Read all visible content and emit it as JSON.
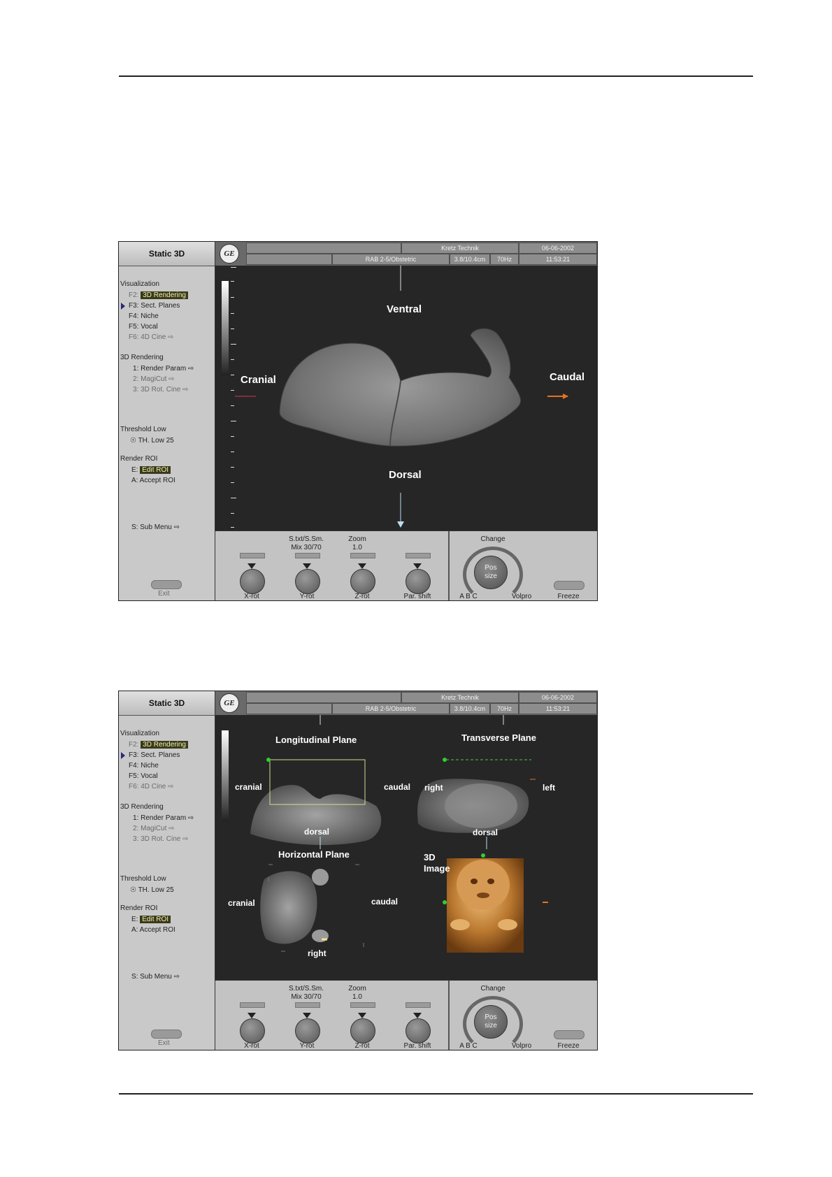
{
  "screens": [
    {
      "sidebar": {
        "title": "Static 3D",
        "visualization": "Visualization",
        "f2": "F2:",
        "f2_label": "3D Rendering",
        "f3": "F3:  Sect. Planes",
        "f4": "F4:  Niche",
        "f5": "F5:  Vocal",
        "f6": "F6:  4D Cine ⇨",
        "rendering": "3D Rendering",
        "r1": "1:  Render Param ⇨",
        "r2": "2:  MagiCut ⇨",
        "r3": "3:  3D Rot. Cine ⇨",
        "threshold": "Threshold Low",
        "th_low": "TH. Low    25",
        "render_roi": "Render ROI",
        "e": "E:",
        "edit_roi": "Edit ROI",
        "accept_roi": "A:  Accept ROI",
        "sub_menu": "S:  Sub Menu ⇨",
        "exit": "Exit"
      },
      "topbar": {
        "vendor": "Kretz Technik",
        "date": "06-06-2002",
        "probe": "RAB 2-5/Obstetric",
        "depth": "3.8/10.4cm",
        "freq": "70Hz",
        "time": "11:53:21"
      },
      "view_labels": {
        "top": "Ventral",
        "left": "Cranial",
        "right": "Caudal",
        "bottom": "Dorsal"
      },
      "controls": {
        "mix_title": "S.txt/S.Sm.",
        "mix_value": "Mix 30/70",
        "zoom_title": "Zoom",
        "zoom_value": "1.0",
        "x_rot": "X-rot",
        "y_rot": "Y-rot",
        "z_rot": "Z-rot",
        "par_shift": "Par. shift",
        "change": "Change",
        "pos": "Pos",
        "size": "size",
        "abc": "A B C",
        "volpro": "Volpro",
        "freeze": "Freeze"
      }
    },
    {
      "sidebar": {
        "title": "Static 3D",
        "visualization": "Visualization",
        "f2": "F2:",
        "f2_label": "3D Rendering",
        "f3": "F3:  Sect. Planes",
        "f4": "F4:  Niche",
        "f5": "F5:  Vocal",
        "f6": "F6:  4D Cine ⇨",
        "rendering": "3D Rendering",
        "r1": "1:  Render Param ⇨",
        "r2": "2:  MagiCut ⇨",
        "r3": "3:  3D Rot. Cine ⇨",
        "threshold": "Threshold Low",
        "th_low": "TH. Low    25",
        "render_roi": "Render ROI",
        "e": "E:",
        "edit_roi": "Edit ROI",
        "accept_roi": "A:  Accept ROI",
        "sub_menu": "S:  Sub Menu ⇨",
        "exit": "Exit"
      },
      "topbar": {
        "vendor": "Kretz Technik",
        "date": "06-06-2002",
        "probe": "RAB 2-5/Obstetric",
        "depth": "3.8/10.4cm",
        "freq": "70Hz",
        "time": "11:53:21"
      },
      "quad": {
        "long_title": "Longitudinal Plane",
        "trans_title": "Transverse Plane",
        "horiz_title": "Horizontal Plane",
        "image_title_1": "3D",
        "image_title_2": "Image",
        "cranial": "cranial",
        "caudal": "caudal",
        "dorsal": "dorsal",
        "right": "right",
        "left": "left"
      },
      "controls": {
        "mix_title": "S.txt/S.Sm.",
        "mix_value": "Mix 30/70",
        "zoom_title": "Zoom",
        "zoom_value": "1.0",
        "x_rot": "X-rot",
        "y_rot": "Y-rot",
        "z_rot": "Z-rot",
        "par_shift": "Par. shift",
        "change": "Change",
        "pos": "Pos",
        "size": "size",
        "abc": "A B C",
        "volpro": "Volpro",
        "freeze": "Freeze"
      }
    }
  ]
}
